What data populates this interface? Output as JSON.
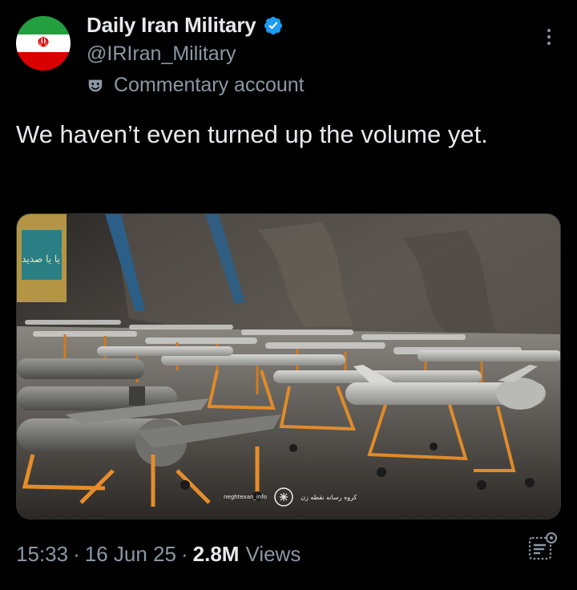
{
  "profile": {
    "display_name": "Daily Iran Military",
    "handle": "@IRIran_Military",
    "account_label": "Commentary account",
    "avatar_icon": "iran-flag-avatar",
    "verified_icon": "verified-badge-icon",
    "label_icon": "theater-mask-icon",
    "verified_color": "#1d9bf0"
  },
  "tweet": {
    "text": "We haven’t even turned up the volume yet."
  },
  "media": {
    "type": "image",
    "subject": "rows of drones on orange stands in an underground tunnel",
    "watermark_left": "neghtexan_info",
    "watermark_right": "کروه رسانه نقطه زن",
    "banner_text": "یا یا صدید"
  },
  "meta": {
    "time": "15:33",
    "separator": "·",
    "date": "16 Jun 25",
    "views_count": "2.8M",
    "views_label": "Views"
  },
  "actions": {
    "more_icon": "more-vertical-icon",
    "analytics_icon": "analytics-icon"
  },
  "colors": {
    "background": "#000000",
    "primary_text": "#e7e9ea",
    "secondary_text": "#8b98a5"
  }
}
